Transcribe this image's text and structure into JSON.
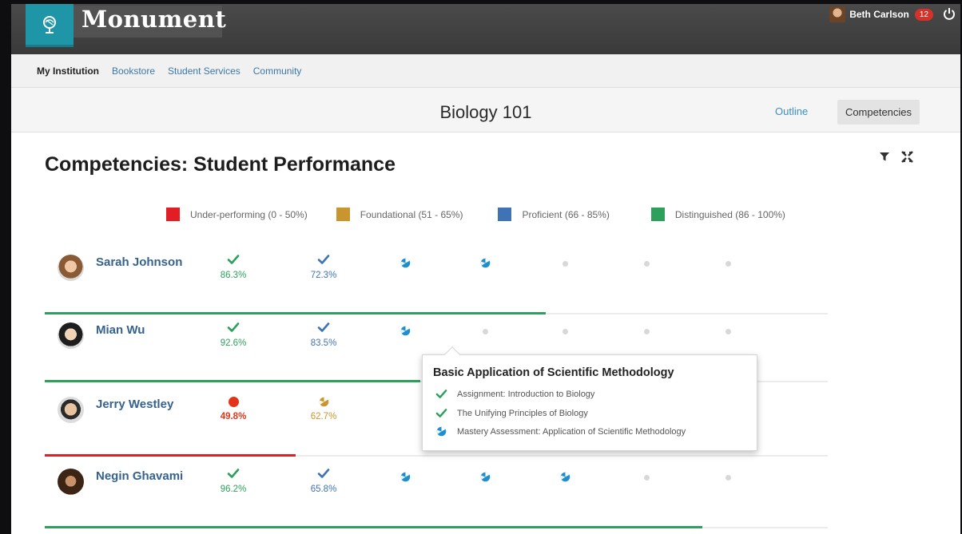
{
  "header": {
    "app_name": "Monument",
    "user_name": "Beth Carlson",
    "notification_count": "12"
  },
  "nav": {
    "items": [
      "My Institution",
      "Bookstore",
      "Student Services",
      "Community"
    ],
    "active": "My Institution"
  },
  "course": {
    "title": "Biology 101",
    "tabs": [
      "Outline",
      "Competencies"
    ],
    "active_tab": "Competencies"
  },
  "page": {
    "heading": "Competencies: Student Performance"
  },
  "legend": [
    {
      "label": "Under-performing (0 - 50%)",
      "color": "#e21d24"
    },
    {
      "label": "Foundational (51 - 65%)",
      "color": "#c9952e"
    },
    {
      "label": "Proficient (66 - 85%)",
      "color": "#3f73b5"
    },
    {
      "label": "Distinguished (86 - 100%)",
      "color": "#2da15c"
    }
  ],
  "students": [
    {
      "name": "Sarah Johnson",
      "progress": 0.64,
      "bar_color": "#2da15c",
      "cells": [
        {
          "kind": "check",
          "pct": "86.3%",
          "color": "#2da15c"
        },
        {
          "kind": "check",
          "pct": "72.3%",
          "color": "#3f73b5"
        },
        {
          "kind": "partial",
          "color": "#1d8fcf"
        },
        {
          "kind": "partial",
          "color": "#1d8fcf"
        },
        {
          "kind": "empty"
        },
        {
          "kind": "empty"
        },
        {
          "kind": "empty"
        }
      ]
    },
    {
      "name": "Mian Wu",
      "progress": 0.48,
      "bar_color": "#2da15c",
      "cells": [
        {
          "kind": "check",
          "pct": "92.6%",
          "color": "#2da15c"
        },
        {
          "kind": "check",
          "pct": "83.5%",
          "color": "#3f73b5"
        },
        {
          "kind": "partial",
          "color": "#1d8fcf"
        },
        {
          "kind": "empty"
        },
        {
          "kind": "empty"
        },
        {
          "kind": "empty"
        },
        {
          "kind": "empty"
        }
      ]
    },
    {
      "name": "Jerry Westley",
      "progress": 0.32,
      "bar_color": "#e21d24",
      "cells": [
        {
          "kind": "fail",
          "pct": "49.8%",
          "color": "#e33419"
        },
        {
          "kind": "partial-warn",
          "pct": "62.7%",
          "color": "#c9952e"
        },
        {
          "kind": "hidden"
        },
        {
          "kind": "hidden"
        },
        {
          "kind": "hidden"
        },
        {
          "kind": "hidden"
        },
        {
          "kind": "empty"
        }
      ]
    },
    {
      "name": "Negin Ghavami",
      "progress": 0.84,
      "bar_color": "#2da15c",
      "cells": [
        {
          "kind": "check",
          "pct": "96.2%",
          "color": "#2da15c"
        },
        {
          "kind": "check",
          "pct": "65.8%",
          "color": "#3f73b5"
        },
        {
          "kind": "partial",
          "color": "#1d8fcf"
        },
        {
          "kind": "partial",
          "color": "#1d8fcf"
        },
        {
          "kind": "partial",
          "color": "#1d8fcf"
        },
        {
          "kind": "empty"
        },
        {
          "kind": "empty"
        }
      ]
    }
  ],
  "popup": {
    "title": "Basic Application of Scientific Methodology",
    "items": [
      {
        "icon": "check-icon",
        "label": "Assignment: Introduction to Biology",
        "color": "#2da15c"
      },
      {
        "icon": "check-icon",
        "label": "The Unifying Principles of Biology",
        "color": "#2da15c"
      },
      {
        "icon": "partial-progress-icon",
        "label": "Mastery Assessment: Application of Scientific Methodology",
        "color": "#1d8fcf"
      }
    ]
  }
}
